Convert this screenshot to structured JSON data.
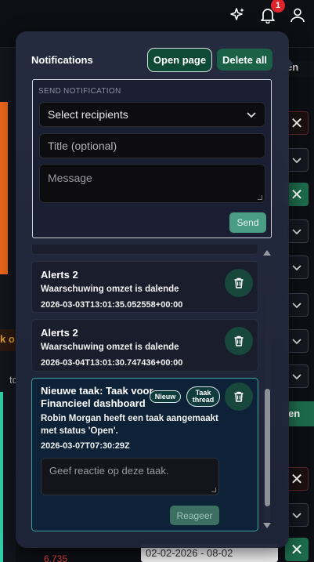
{
  "topbar": {
    "sparkle_icon": "sparkle-icon",
    "bell_icon": "bell-icon",
    "notification_count": "1",
    "user_icon": "user-icon"
  },
  "background": {
    "partial_text_left": "k o",
    "partial_text_tc": "tc",
    "partial_button_right_1": "en",
    "partial_button_right_2": "en",
    "partial_value_bottom": "6.735",
    "partial_date_range": "02-02-2026 - 08-02"
  },
  "panel": {
    "title": "Notifications",
    "open_page_label": "Open page",
    "delete_all_label": "Delete all",
    "send": {
      "section_label": "SEND NOTIFICATION",
      "recipients_placeholder": "Select recipients",
      "title_placeholder": "Title (optional)",
      "message_placeholder": "Message",
      "send_label": "Send"
    },
    "notifications": [
      {
        "title": "Alerts 2",
        "message": "Waarschuwing omzet is dalende",
        "timestamp": "2026-03-03T13:01:35.052558+00:00"
      },
      {
        "title": "Alerts 2",
        "message": "Waarschuwing omzet is dalende",
        "timestamp": "2026-03-04T13:01:30.747436+00:00"
      },
      {
        "title_line1": "Nieuwe taak: Taak voor",
        "title_line2": "Financieel dashboard",
        "badge_new": "Nieuw",
        "badge_thread_line1": "Taak",
        "badge_thread_line2": "thread",
        "message_line1": "Robin Morgan heeft een taak aangemaakt",
        "message_line2": "met status 'Open'.",
        "timestamp": "2026-03-07T07:30:29Z",
        "reply_placeholder": "Geef reactie op deze taak.",
        "reply_label": "Reageer"
      }
    ]
  },
  "colors": {
    "accent_green": "#1a6147",
    "badge_red": "#e0242c",
    "task_border": "#3aa3a0"
  }
}
